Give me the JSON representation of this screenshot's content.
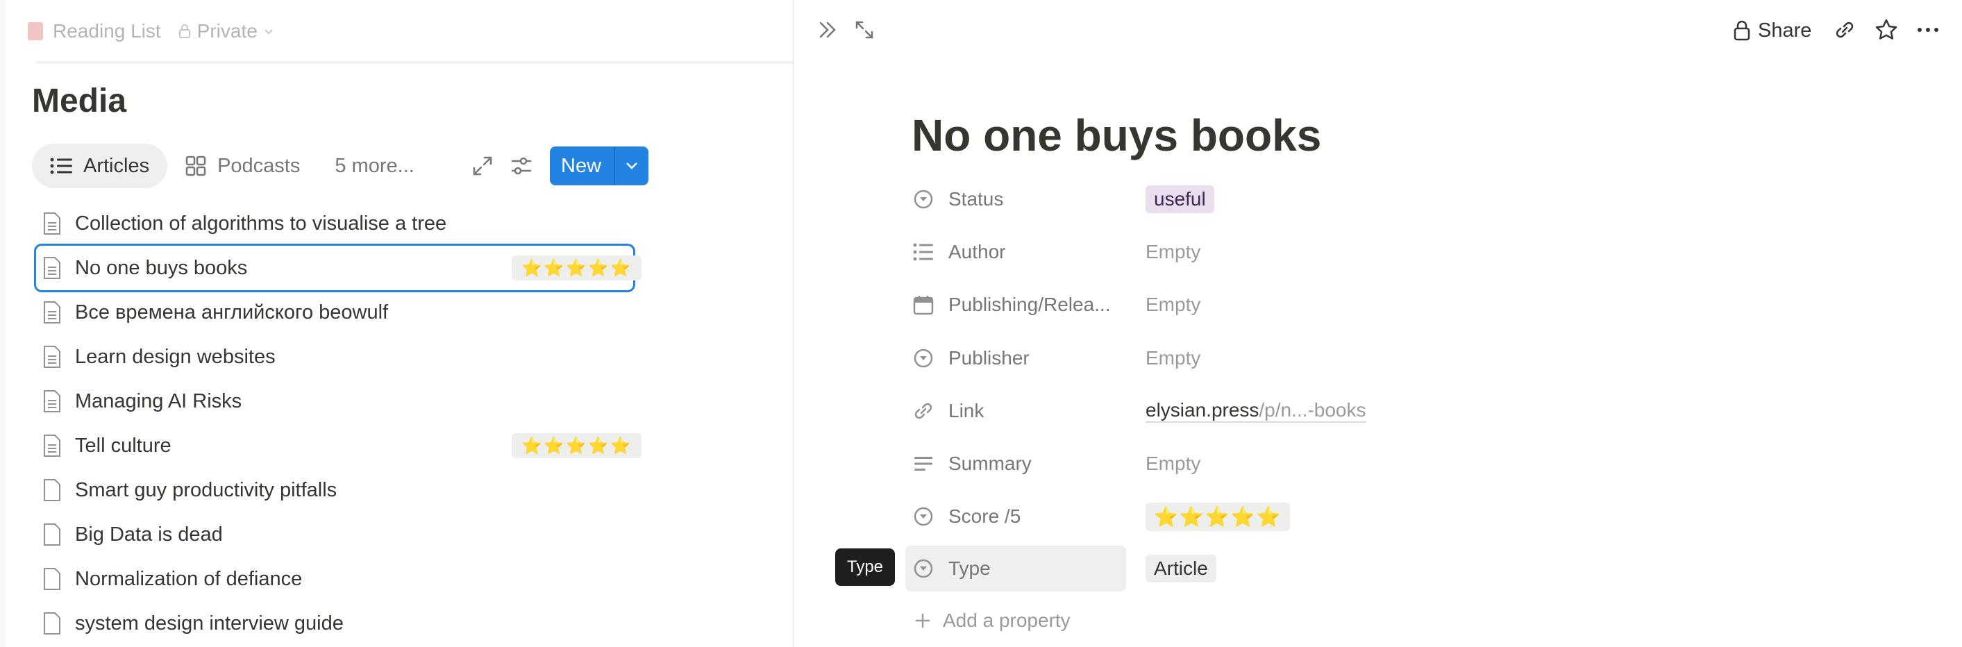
{
  "topbar": {
    "breadcrumb": "Reading List",
    "privacy": "Private"
  },
  "database": {
    "title": "Media",
    "tabs": [
      {
        "label": "Articles",
        "icon": "list-icon",
        "active": true
      },
      {
        "label": "Podcasts",
        "icon": "gallery-icon",
        "active": false
      }
    ],
    "more_views": "5 more...",
    "new_label": "New"
  },
  "list": {
    "rows": [
      {
        "title": "Collection of algorithms to visualise a tree",
        "score": ""
      },
      {
        "title": "No one buys books",
        "score": "⭐⭐⭐⭐⭐",
        "selected": true
      },
      {
        "title": "Все времена английского beowulf",
        "score": ""
      },
      {
        "title": "Learn design websites",
        "score": ""
      },
      {
        "title": "Managing AI Risks",
        "score": ""
      },
      {
        "title": "Tell culture",
        "score": "⭐⭐⭐⭐⭐"
      },
      {
        "title": "Smart guy productivity pitfalls",
        "score": ""
      },
      {
        "title": "Big Data is dead",
        "score": ""
      },
      {
        "title": "Normalization of defiance",
        "score": ""
      },
      {
        "title": "system design interview guide",
        "score": ""
      }
    ]
  },
  "page": {
    "share_label": "Share",
    "title": "No one buys books",
    "properties": {
      "status": {
        "label": "Status",
        "value": "useful"
      },
      "author": {
        "label": "Author",
        "value": "Empty"
      },
      "publishing": {
        "label": "Publishing/Relea...",
        "value": "Empty"
      },
      "publisher": {
        "label": "Publisher",
        "value": "Empty"
      },
      "link": {
        "label": "Link",
        "value_main": "elysian.press",
        "value_rest": "/p/n...-books"
      },
      "summary": {
        "label": "Summary",
        "value": "Empty"
      },
      "score": {
        "label": "Score /5",
        "value": "⭐⭐⭐⭐⭐"
      },
      "type": {
        "label": "Type",
        "value": "Article"
      }
    },
    "tooltip": "Type",
    "add_property": "Add a property"
  },
  "colors": {
    "accent": "#2383e2",
    "status_tag": "#e8deee",
    "text": "#37352f",
    "muted": "#9b9a97"
  }
}
